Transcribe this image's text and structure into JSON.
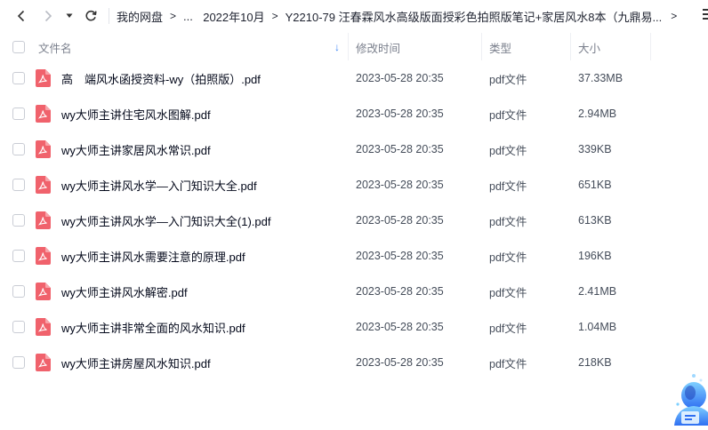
{
  "breadcrumb": {
    "root": "我的网盘",
    "ellipsis": "...",
    "folder1": "2022年10月",
    "folder2": "Y2210-79 汪春霖风水高级版面授彩色拍照版笔记+家居风水8本（九鼎易..."
  },
  "table": {
    "columns": {
      "name": "文件名",
      "modified": "修改时间",
      "type": "类型",
      "size": "大小"
    },
    "rows": [
      {
        "name": "高　端风水函授资料-wy（拍照版）.pdf",
        "modified": "2023-05-28 20:35",
        "type": "pdf文件",
        "size": "37.33MB"
      },
      {
        "name": "wy大师主讲住宅风水图解.pdf",
        "modified": "2023-05-28 20:35",
        "type": "pdf文件",
        "size": "2.94MB"
      },
      {
        "name": "wy大师主讲家居风水常识.pdf",
        "modified": "2023-05-28 20:35",
        "type": "pdf文件",
        "size": "339KB"
      },
      {
        "name": "wy大师主讲风水学—入门知识大全.pdf",
        "modified": "2023-05-28 20:35",
        "type": "pdf文件",
        "size": "651KB"
      },
      {
        "name": "wy大师主讲风水学—入门知识大全(1).pdf",
        "modified": "2023-05-28 20:35",
        "type": "pdf文件",
        "size": "613KB"
      },
      {
        "name": "wy大师主讲风水需要注意的原理.pdf",
        "modified": "2023-05-28 20:35",
        "type": "pdf文件",
        "size": "196KB"
      },
      {
        "name": "wy大师主讲风水解密.pdf",
        "modified": "2023-05-28 20:35",
        "type": "pdf文件",
        "size": "2.41MB"
      },
      {
        "name": "wy大师主讲非常全面的风水知识.pdf",
        "modified": "2023-05-28 20:35",
        "type": "pdf文件",
        "size": "1.04MB"
      },
      {
        "name": "wy大师主讲房屋风水知识.pdf",
        "modified": "2023-05-28 20:35",
        "type": "pdf文件",
        "size": "218KB"
      }
    ]
  },
  "colors": {
    "pdf_icon": "#f0626c",
    "sort_arrow": "#3e86f6",
    "text_primary": "#03081a",
    "text_secondary": "#454d5a"
  },
  "icons": {
    "back": "chevron-left-icon",
    "forward": "chevron-right-icon",
    "history": "caret-down-icon",
    "refresh": "refresh-icon",
    "file": "pdf-file-icon",
    "menu": "menu-icon"
  }
}
